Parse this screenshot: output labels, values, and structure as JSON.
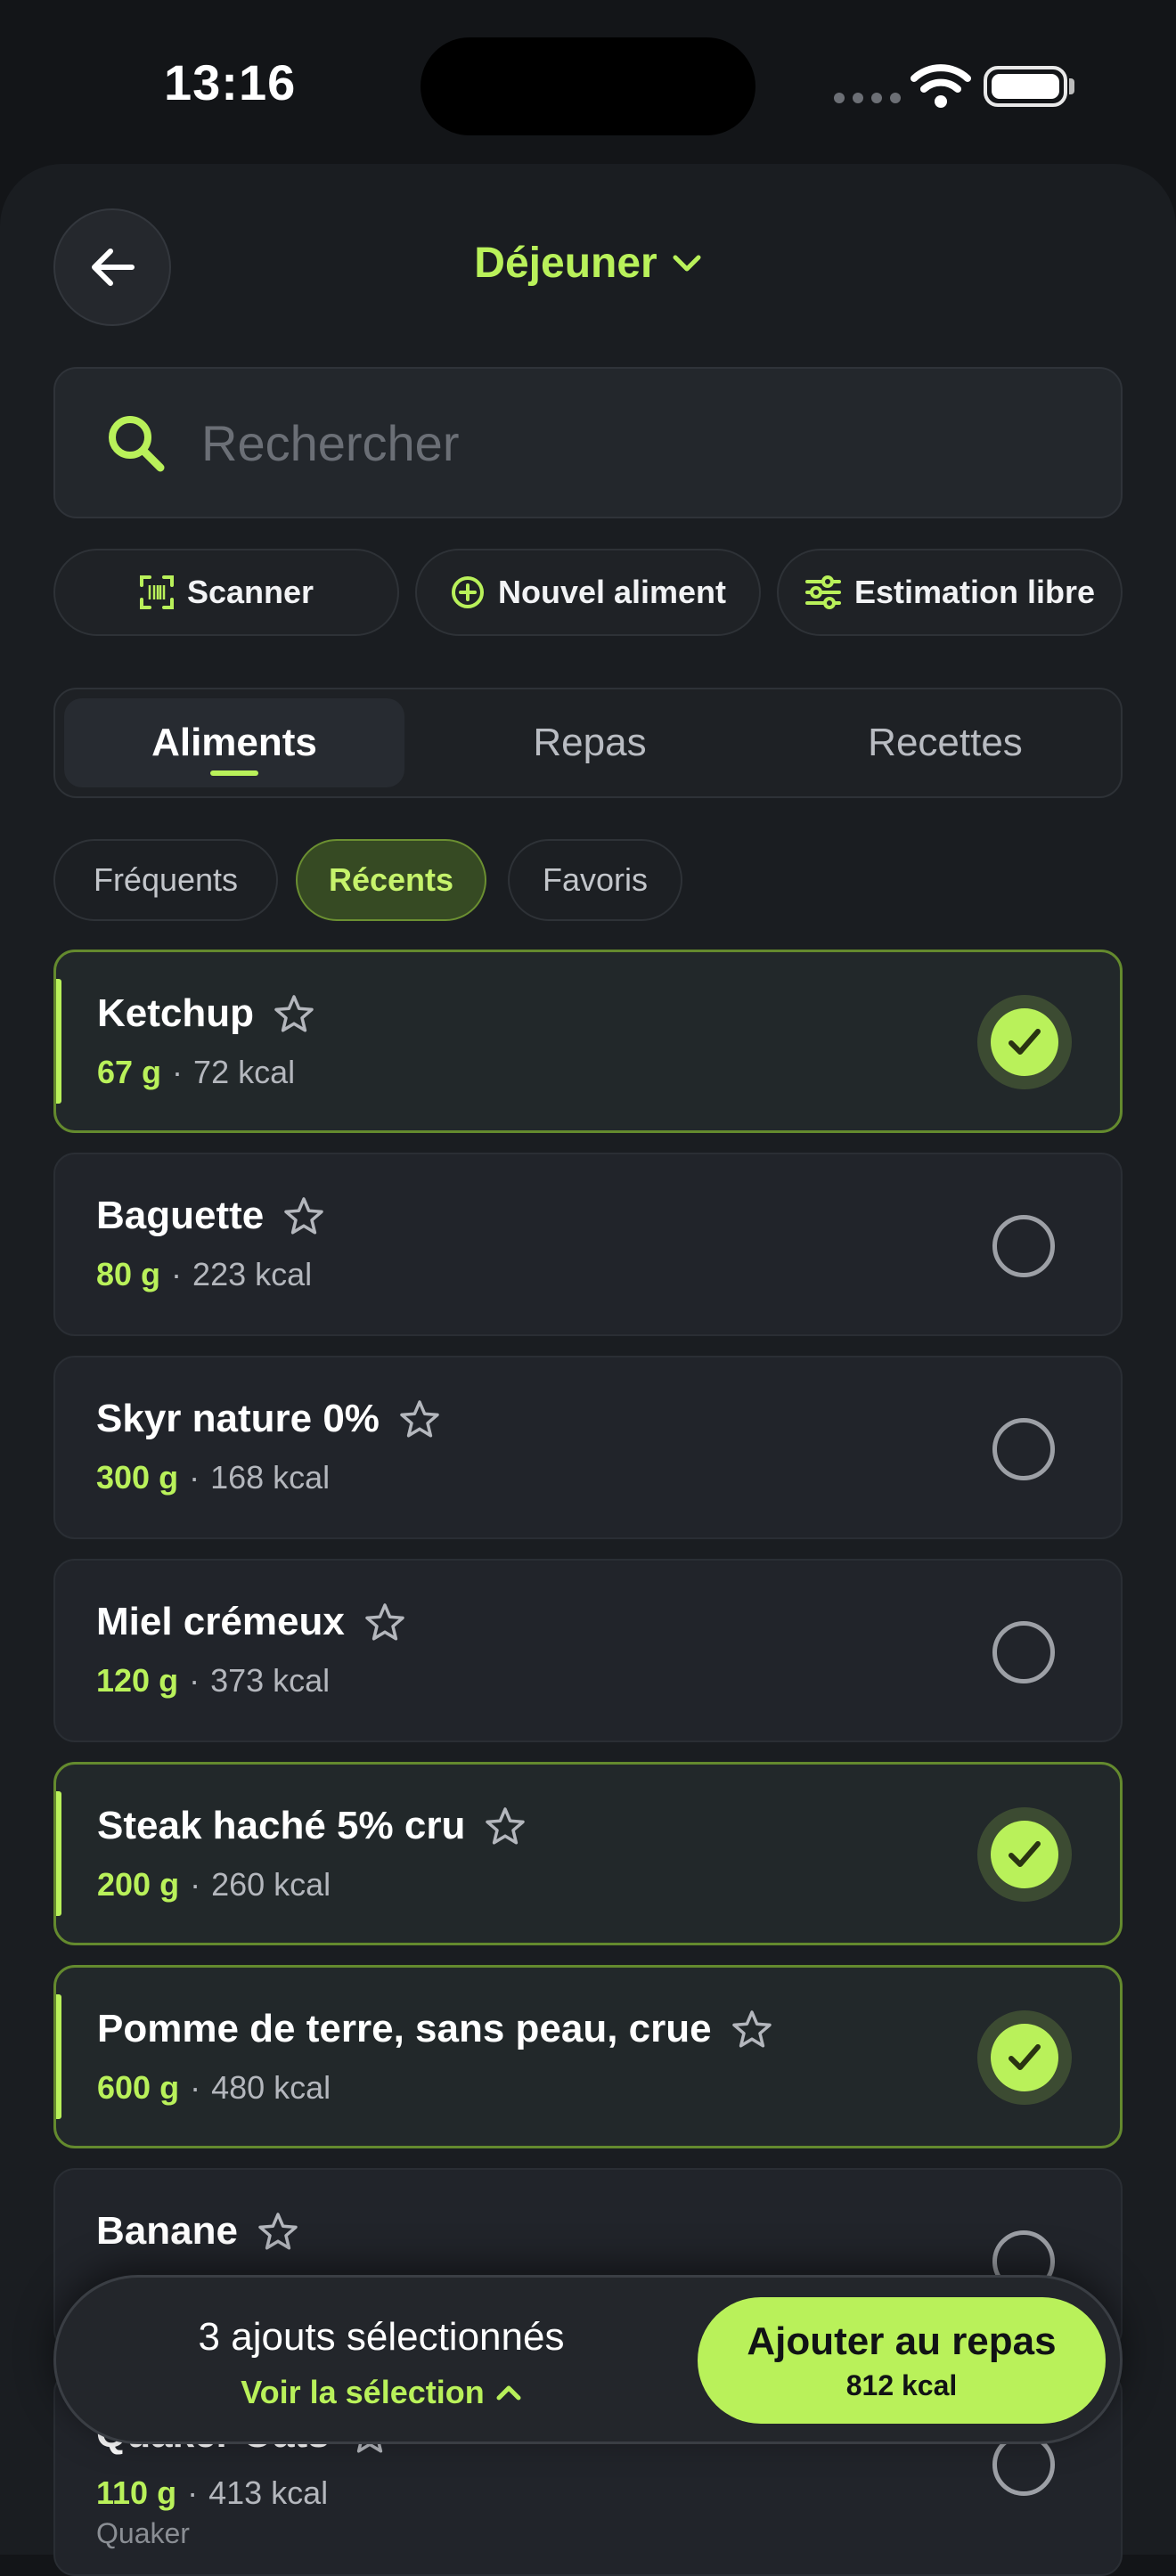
{
  "status_bar": {
    "time": "13:16"
  },
  "header": {
    "title": "Déjeuner"
  },
  "search": {
    "placeholder": "Rechercher"
  },
  "actions": {
    "scanner": "Scanner",
    "new_food": "Nouvel aliment",
    "free_estimate": "Estimation libre"
  },
  "tabs": [
    {
      "label": "Aliments",
      "active": true
    },
    {
      "label": "Repas",
      "active": false
    },
    {
      "label": "Recettes",
      "active": false
    }
  ],
  "filters": [
    {
      "label": "Fréquents",
      "active": false
    },
    {
      "label": "Récents",
      "active": true
    },
    {
      "label": "Favoris",
      "active": false
    }
  ],
  "foods": [
    {
      "name": "Ketchup",
      "qty": "67 g",
      "kcal": "72 kcal",
      "selected": true
    },
    {
      "name": "Baguette",
      "qty": "80 g",
      "kcal": "223 kcal",
      "selected": false
    },
    {
      "name": "Skyr nature 0%",
      "qty": "300 g",
      "kcal": "168 kcal",
      "selected": false
    },
    {
      "name": "Miel crémeux",
      "qty": "120 g",
      "kcal": "373 kcal",
      "selected": false
    },
    {
      "name": "Steak haché 5% cru",
      "qty": "200 g",
      "kcal": "260 kcal",
      "selected": true
    },
    {
      "name": "Pomme de terre, sans peau, crue",
      "qty": "600 g",
      "kcal": "480 kcal",
      "selected": true
    },
    {
      "name": "Banane",
      "qty": "",
      "kcal": "",
      "selected": false
    },
    {
      "name": "Quaker Oats",
      "qty": "110 g",
      "kcal": "413 kcal",
      "brand": "Quaker",
      "selected": false
    }
  ],
  "selection_bar": {
    "count_text": "3 ajouts sélectionnés",
    "view_link": "Voir la sélection",
    "add_button": "Ajouter au repas",
    "total_kcal": "812 kcal"
  },
  "colors": {
    "accent": "#b9f15a",
    "background": "#1a1d21"
  }
}
